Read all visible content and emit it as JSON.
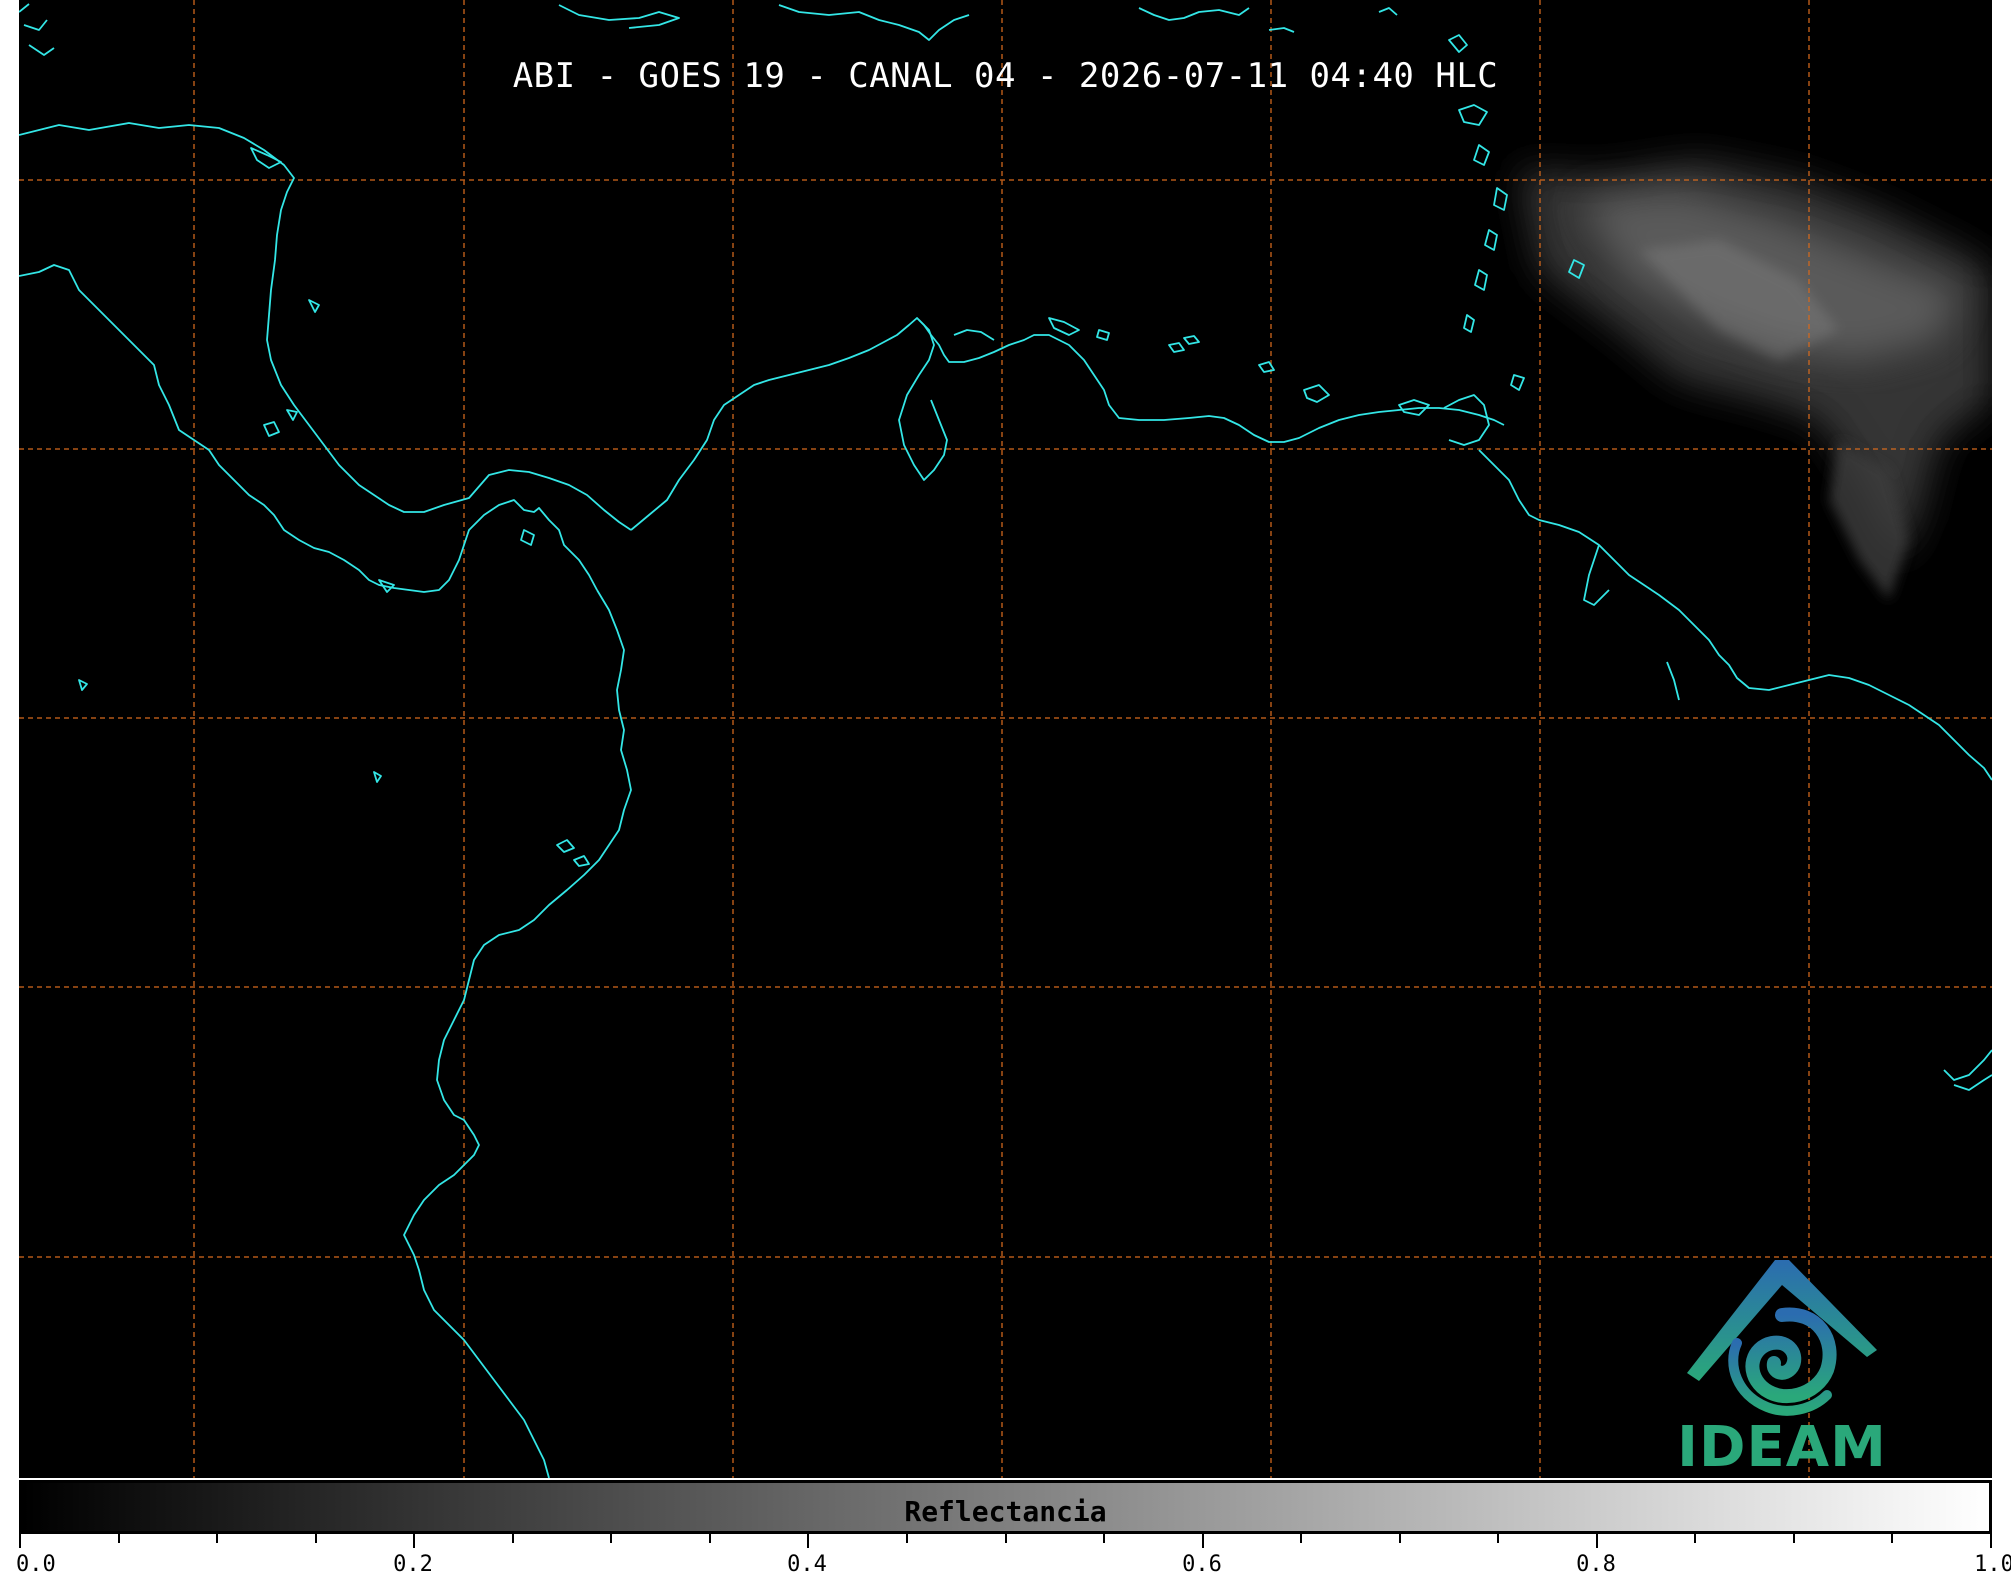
{
  "map": {
    "title": "ABI - GOES 19 - CANAL 04 - 2026-07-11 04:40 HLC",
    "background_color": "#000000",
    "coastline_color": "#33e6e6",
    "gridline_color": "#d2691e",
    "gridline_style": "dashed",
    "cloud_color": "#5a5a5a"
  },
  "logo": {
    "text": "IDEAM",
    "color_top": "#2b6cb0",
    "color_bottom": "#2aa87a"
  },
  "colorbar": {
    "label": "Reflectancia",
    "range": [
      0.0,
      1.0
    ],
    "gradient_start": "#000000",
    "gradient_end": "#ffffff",
    "tick_labels": [
      "0.0",
      "0.2",
      "0.4",
      "0.6",
      "0.8",
      "1.0"
    ]
  }
}
